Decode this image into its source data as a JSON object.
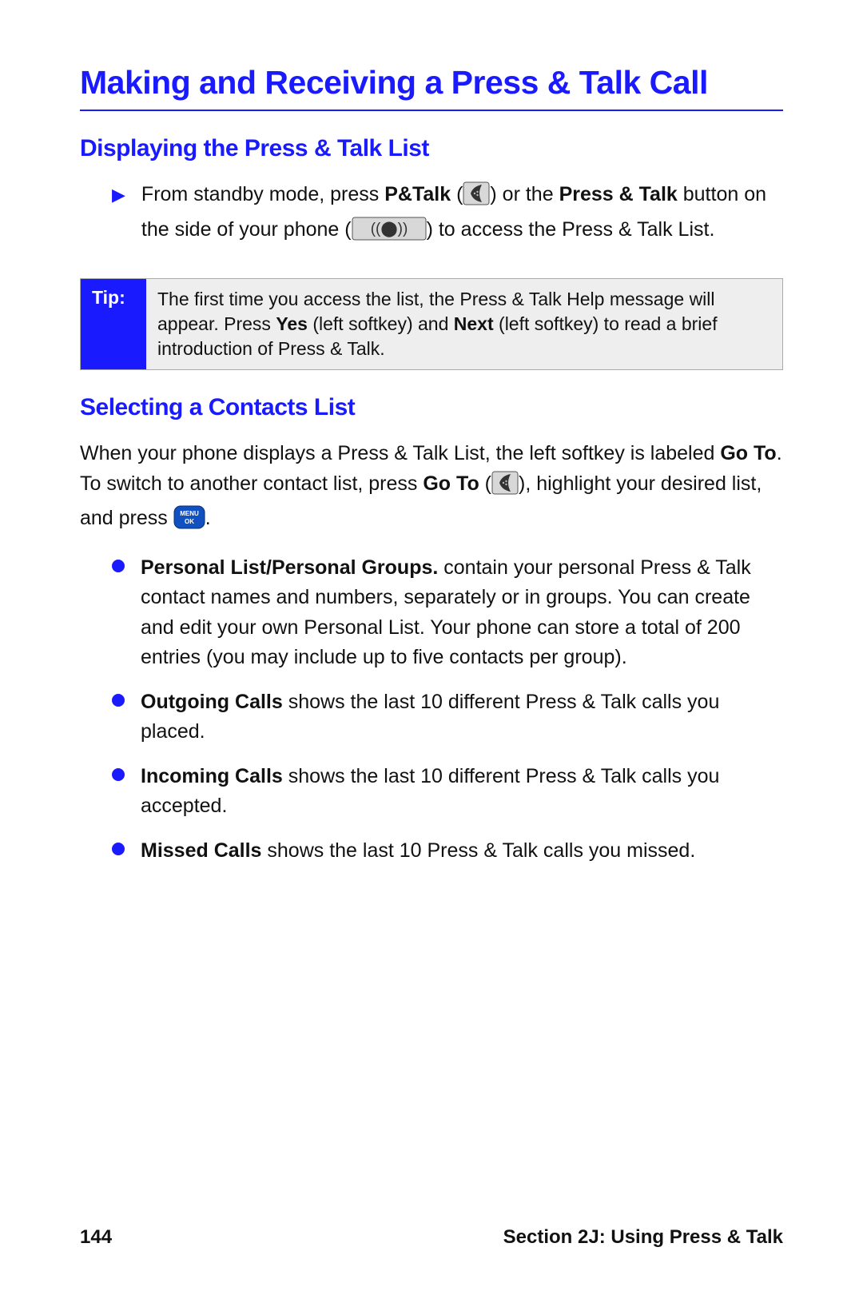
{
  "title": "Making and Receiving a Press & Talk Call",
  "sections": {
    "display_list": {
      "heading": "Displaying the Press & Talk List",
      "step_pre": "From standby mode, press ",
      "step_bold1": "P&Talk",
      "step_mid1": " (",
      "step_mid2": ") or the ",
      "step_bold2": "Press & Talk",
      "step_mid3": " button on the side of your phone (",
      "step_mid4": ") to access the Press & Talk List."
    },
    "tip": {
      "label": "Tip:",
      "pre": "The first time you access the list, the Press & Talk Help message will appear. Press ",
      "bold1": "Yes",
      "mid1": " (left softkey) and ",
      "bold2": "Next",
      "mid2": " (left softkey) to read a brief introduction of Press & Talk."
    },
    "selecting": {
      "heading": "Selecting a Contacts List",
      "para_pre": "When your phone displays a Press & Talk List, the left softkey is labeled ",
      "para_bold1": "Go To",
      "para_mid1": ". To switch to another contact list, press ",
      "para_bold2": "Go To",
      "para_mid2": " (",
      "para_mid3": "), highlight your desired list, and press ",
      "para_mid4": ".",
      "items": [
        {
          "bold": "Personal List/Personal Groups.",
          "text": " contain your personal Press & Talk contact names and numbers, separately or in groups. You can create and edit your own Personal List. Your phone can store a total of 200 entries (you may include up to five contacts per group)."
        },
        {
          "bold": "Outgoing Calls",
          "text": " shows the last 10 different Press & Talk calls you placed."
        },
        {
          "bold": "Incoming Calls",
          "text": " shows the last 10 different Press & Talk calls you accepted."
        },
        {
          "bold": "Missed Calls",
          "text": " shows the last 10 Press & Talk calls you missed."
        }
      ]
    }
  },
  "footer": {
    "page": "144",
    "section": "Section 2J: Using Press & Talk"
  }
}
